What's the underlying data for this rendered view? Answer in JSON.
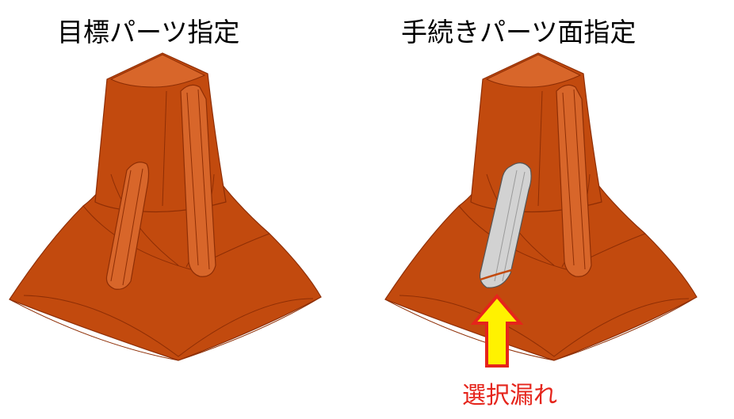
{
  "panels": {
    "left": {
      "title": "目標パーツ指定"
    },
    "right": {
      "title": "手続きパーツ面指定"
    }
  },
  "callout": {
    "label": "選択漏れ"
  },
  "colors": {
    "part_fill": "#C24A0E",
    "part_edge": "#8E2E05",
    "part_highlight": "#D8662A",
    "selected_face": "#D2D2D2",
    "arrow_fill": "#FFF200",
    "arrow_stroke": "#E5241B",
    "callout_text": "#E5241B"
  }
}
